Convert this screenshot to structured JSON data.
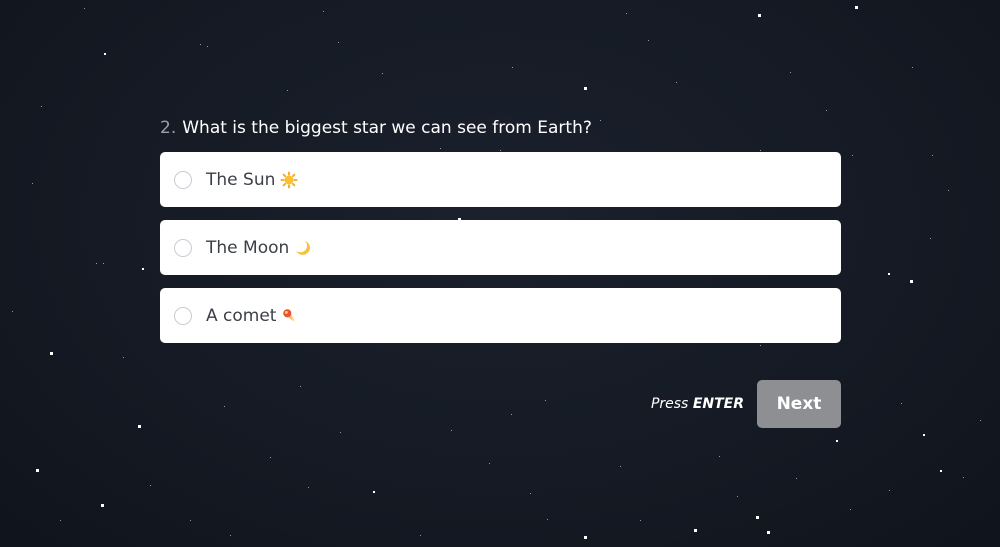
{
  "question": {
    "number": "2.",
    "text": "What is the biggest star we can see from Earth?"
  },
  "options": [
    {
      "label": "The Sun",
      "icon": "sun-emoji-icon"
    },
    {
      "label": "The Moon",
      "icon": "crescent-moon-emoji-icon"
    },
    {
      "label": "A comet",
      "icon": "comet-emoji-icon"
    }
  ],
  "footer": {
    "hint_prefix": "Press",
    "hint_key": "ENTER",
    "next_label": "Next"
  },
  "colors": {
    "background": "#151a24",
    "option_bg": "#ffffff",
    "next_button": "#8d8f93"
  }
}
